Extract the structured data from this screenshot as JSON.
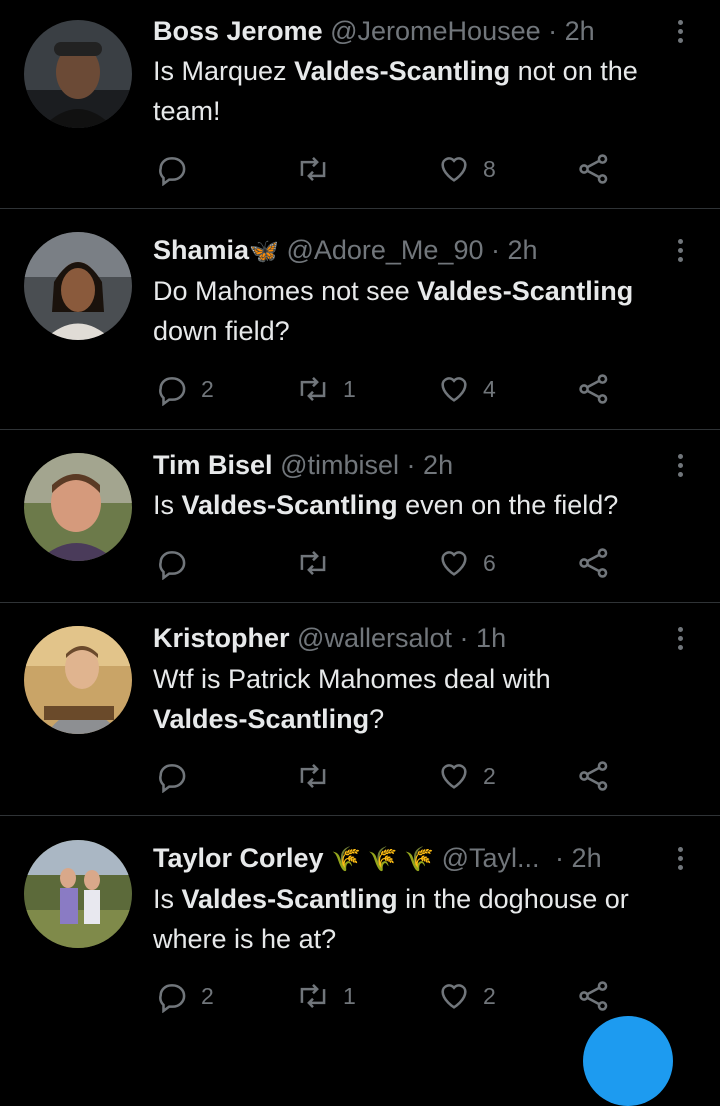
{
  "tweets": [
    {
      "name": "Boss Jerome",
      "name_emoji": "",
      "handle": "@JeromeHousee",
      "dot": "·",
      "time": "2h",
      "text_parts": [
        "Is Marquez ",
        "Valdes-Scantling",
        " not on the",
        "team!"
      ],
      "replies": "",
      "retweets": "",
      "likes": "8"
    },
    {
      "name": "Shamia",
      "name_emoji": "🦋",
      "handle": "@Adore_Me_90",
      "dot": "·",
      "time": "2h",
      "text_parts": [
        "Do Mahomes not see ",
        "Valdes-Scantling",
        "",
        "down field?"
      ],
      "replies": "2",
      "retweets": "1",
      "likes": "4"
    },
    {
      "name": "Tim Bisel",
      "name_emoji": "",
      "handle": "@timbisel",
      "dot": "·",
      "time": "2h",
      "text_parts": [
        "Is ",
        "Valdes-Scantling",
        " even on the field?",
        ""
      ],
      "replies": "",
      "retweets": "",
      "likes": "6"
    },
    {
      "name": "Kristopher",
      "name_emoji": "",
      "handle": "@wallersalot",
      "dot": "·",
      "time": "1h",
      "text_parts": [
        "Wtf is Patrick Mahomes deal with",
        "Valdes-Scantling",
        "?",
        ""
      ],
      "replies": "",
      "retweets": "",
      "likes": "2"
    },
    {
      "name": "Taylor Corley",
      "name_emoji": "🌾 🌾 🌾",
      "handle": "@Tayl...",
      "dot": "·",
      "time": "2h",
      "text_parts": [
        "Is ",
        "Valdes-Scantling",
        " in the doghouse or",
        "where is he at?"
      ],
      "replies": "2",
      "retweets": "1",
      "likes": "2"
    }
  ],
  "colors": {
    "background": "#000000",
    "text": "#e7e9ea",
    "secondary": "#71767b",
    "divider": "#2f3336",
    "accent": "#1d9bf0"
  },
  "icons": [
    "reply-icon",
    "retweet-icon",
    "like-icon",
    "share-icon",
    "more-icon"
  ]
}
